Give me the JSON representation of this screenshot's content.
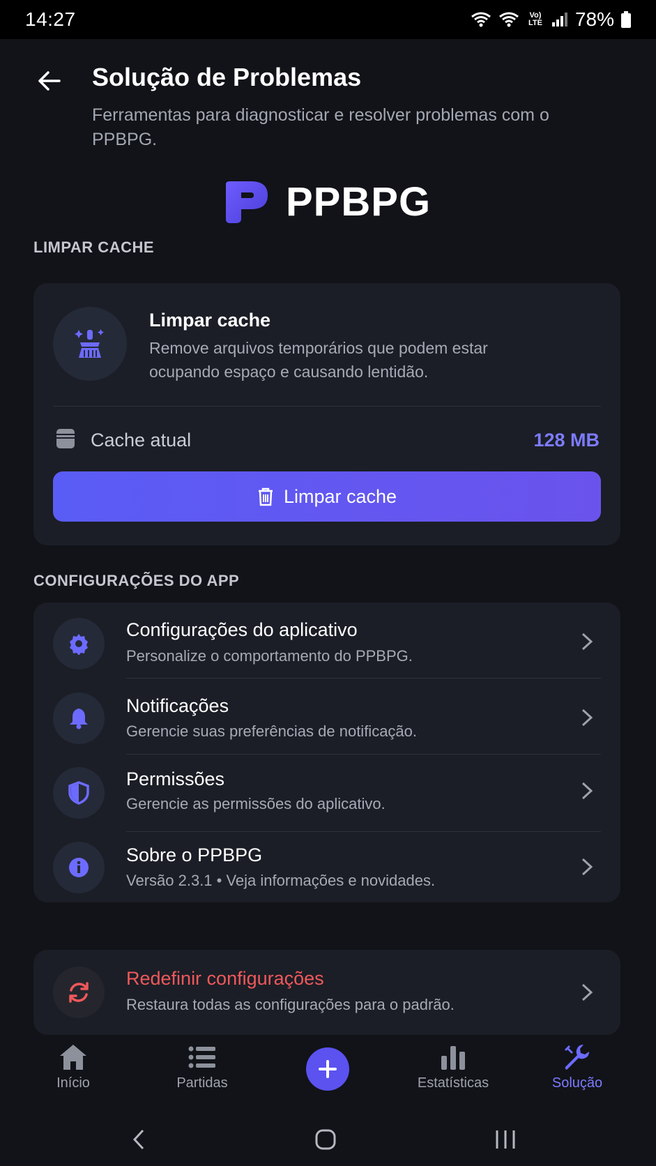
{
  "status_bar": {
    "time": "14:27",
    "network": "Vo) LTE",
    "battery": "78%"
  },
  "header": {
    "title": "Solução de Problemas",
    "subtitle": "Ferramentas para diagnosticar e resolver problemas com o PPBPG."
  },
  "logo": {
    "wordmark": "PPBPG"
  },
  "cache_section": {
    "label": "LIMPAR CACHE",
    "title": "Limpar cache",
    "description": "Remove arquivos temporários que podem estar ocupando espaço e causando lentidão.",
    "current_label": "Cache atual",
    "current_value": "128 MB",
    "button_label": "Limpar cache"
  },
  "settings_section": {
    "label": "CONFIGURAÇÕES DO APP",
    "items": [
      {
        "title": "Configurações do aplicativo",
        "description": "Personalize o comportamento do PPBPG.",
        "icon": "gear-icon"
      },
      {
        "title": "Notificações",
        "description": "Gerencie suas preferências de notificação.",
        "icon": "bell-icon"
      },
      {
        "title": "Permissões",
        "description": "Gerencie as permissões do aplicativo.",
        "icon": "shield-icon"
      },
      {
        "title": "Sobre o PPBPG",
        "description": "Versão 2.3.1 • Veja informações e novidades.",
        "icon": "info-icon"
      }
    ]
  },
  "reset": {
    "title": "Redefinir configurações",
    "description": "Restaura todas as configurações para o padrão.",
    "color": "#f0585b"
  },
  "bottom_nav": {
    "items": [
      {
        "label": "Início",
        "icon": "home-icon"
      },
      {
        "label": "Partidas",
        "icon": "list-icon"
      },
      {
        "label": "Estatísticas",
        "icon": "bar-chart-icon"
      },
      {
        "label": "Solução",
        "icon": "wrench-icon",
        "active": true
      }
    ]
  },
  "colors": {
    "accent": "#5b52f0",
    "accent_text": "#7d7bff",
    "background": "#111318",
    "card": "#1b1e26"
  }
}
